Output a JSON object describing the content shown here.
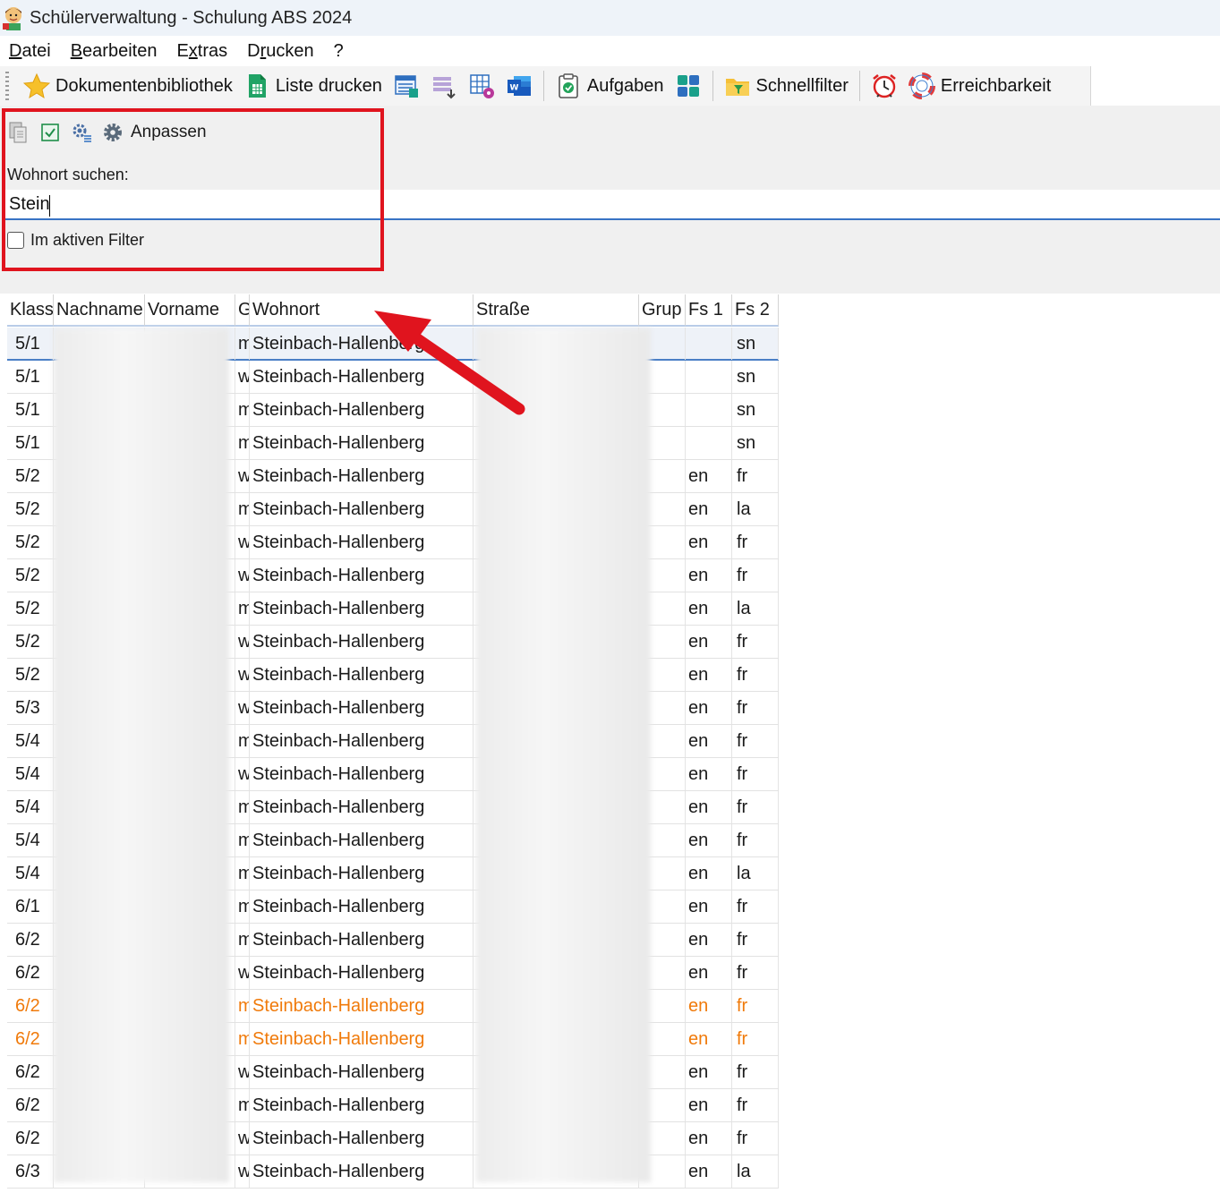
{
  "window": {
    "title": "Schülerverwaltung - Schulung ABS 2024"
  },
  "menu": [
    {
      "pre": "",
      "u": "D",
      "post": "atei"
    },
    {
      "pre": "",
      "u": "B",
      "post": "earbeiten"
    },
    {
      "pre": "E",
      "u": "x",
      "post": "tras"
    },
    {
      "pre": "D",
      "u": "r",
      "post": "ucken"
    },
    {
      "pre": "",
      "u": "",
      "post": "?"
    }
  ],
  "toolbar": {
    "library_label": "Dokumentenbibliothek",
    "print_list_label": "Liste drucken",
    "tasks_label": "Aufgaben",
    "quickfilter_label": "Schnellfilter",
    "reachability_label": "Erreichbarkeit"
  },
  "search_panel": {
    "customize_label": "Anpassen",
    "search_label": "Wohnort suchen:",
    "search_value": "Stein",
    "active_filter_label": "Im aktiven Filter",
    "active_filter_checked": false
  },
  "table": {
    "columns": [
      "Klass",
      "Nachname",
      "Vorname",
      "G",
      "Wohnort",
      "Straße",
      "Grup",
      "Fs 1",
      "Fs 2"
    ],
    "rows": [
      {
        "klasse": "5/1",
        "g": "m",
        "wohnort": "Steinbach-Hallenberg",
        "fs1": "",
        "fs2": "sn",
        "selected": true
      },
      {
        "klasse": "5/1",
        "g": "w",
        "wohnort": "Steinbach-Hallenberg",
        "fs1": "",
        "fs2": "sn"
      },
      {
        "klasse": "5/1",
        "g": "m",
        "wohnort": "Steinbach-Hallenberg",
        "fs1": "",
        "fs2": "sn"
      },
      {
        "klasse": "5/1",
        "g": "m",
        "wohnort": "Steinbach-Hallenberg",
        "fs1": "",
        "fs2": "sn"
      },
      {
        "klasse": "5/2",
        "g": "w",
        "wohnort": "Steinbach-Hallenberg",
        "fs1": "en",
        "fs2": "fr"
      },
      {
        "klasse": "5/2",
        "g": "m",
        "wohnort": "Steinbach-Hallenberg",
        "fs1": "en",
        "fs2": "la"
      },
      {
        "klasse": "5/2",
        "g": "w",
        "wohnort": "Steinbach-Hallenberg",
        "fs1": "en",
        "fs2": "fr"
      },
      {
        "klasse": "5/2",
        "g": "w",
        "wohnort": "Steinbach-Hallenberg",
        "fs1": "en",
        "fs2": "fr"
      },
      {
        "klasse": "5/2",
        "g": "m",
        "wohnort": "Steinbach-Hallenberg",
        "fs1": "en",
        "fs2": "la"
      },
      {
        "klasse": "5/2",
        "g": "w",
        "wohnort": "Steinbach-Hallenberg",
        "fs1": "en",
        "fs2": "fr"
      },
      {
        "klasse": "5/2",
        "g": "w",
        "wohnort": "Steinbach-Hallenberg",
        "fs1": "en",
        "fs2": "fr"
      },
      {
        "klasse": "5/3",
        "g": "w",
        "wohnort": "Steinbach-Hallenberg",
        "fs1": "en",
        "fs2": "fr"
      },
      {
        "klasse": "5/4",
        "g": "m",
        "wohnort": "Steinbach-Hallenberg",
        "fs1": "en",
        "fs2": "fr"
      },
      {
        "klasse": "5/4",
        "g": "w",
        "wohnort": "Steinbach-Hallenberg",
        "fs1": "en",
        "fs2": "fr"
      },
      {
        "klasse": "5/4",
        "g": "m",
        "wohnort": "Steinbach-Hallenberg",
        "fs1": "en",
        "fs2": "fr"
      },
      {
        "klasse": "5/4",
        "g": "m",
        "wohnort": "Steinbach-Hallenberg",
        "fs1": "en",
        "fs2": "fr"
      },
      {
        "klasse": "5/4",
        "g": "m",
        "wohnort": "Steinbach-Hallenberg",
        "fs1": "en",
        "fs2": "la"
      },
      {
        "klasse": "6/1",
        "g": "m",
        "wohnort": "Steinbach-Hallenberg",
        "fs1": "en",
        "fs2": "fr"
      },
      {
        "klasse": "6/2",
        "g": "m",
        "wohnort": "Steinbach-Hallenberg",
        "fs1": "en",
        "fs2": "fr"
      },
      {
        "klasse": "6/2",
        "g": "w",
        "wohnort": "Steinbach-Hallenberg",
        "fs1": "en",
        "fs2": "fr"
      },
      {
        "klasse": "6/2",
        "g": "m",
        "wohnort": "Steinbach-Hallenberg",
        "fs1": "en",
        "fs2": "fr",
        "highlight": true
      },
      {
        "klasse": "6/2",
        "g": "m",
        "wohnort": "Steinbach-Hallenberg",
        "fs1": "en",
        "fs2": "fr",
        "highlight": true
      },
      {
        "klasse": "6/2",
        "g": "w",
        "wohnort": "Steinbach-Hallenberg",
        "fs1": "en",
        "fs2": "fr"
      },
      {
        "klasse": "6/2",
        "g": "m",
        "wohnort": "Steinbach-Hallenberg",
        "fs1": "en",
        "fs2": "fr"
      },
      {
        "klasse": "6/2",
        "g": "w",
        "wohnort": "Steinbach-Hallenberg",
        "fs1": "en",
        "fs2": "fr"
      },
      {
        "klasse": "6/3",
        "g": "w",
        "wohnort": "Steinbach-Hallenberg",
        "fs1": "en",
        "fs2": "la"
      }
    ]
  },
  "colors": {
    "highlight_text": "#f07a0a",
    "annotation_red": "#e0141e",
    "selection_border": "#4a7fc6"
  }
}
